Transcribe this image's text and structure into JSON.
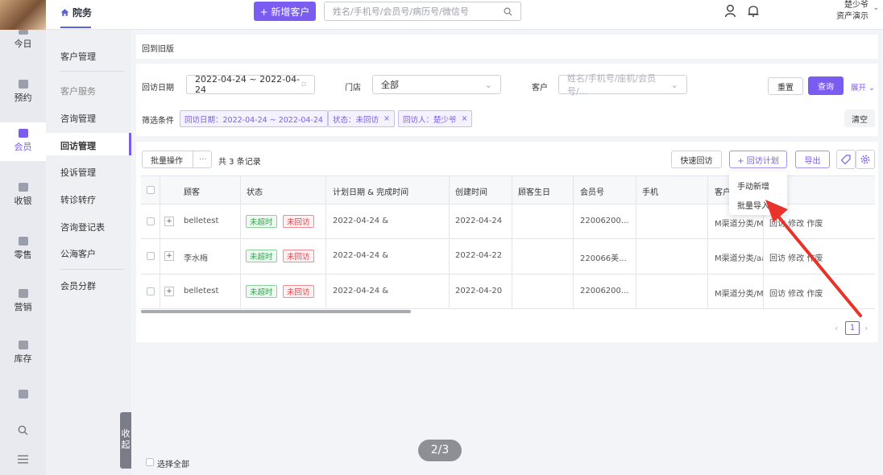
{
  "top": {
    "brand": "院务",
    "add_customer": "+ 新增客户",
    "search_placeholder": "姓名/手机号/会员号/病历号/微信号",
    "user_name": "楚少爷",
    "user_role": "资产演示"
  },
  "leftnav": [
    {
      "label": "今日",
      "icon": "calendar-icon"
    },
    {
      "label": "预约",
      "icon": "appointment-icon"
    },
    {
      "label": "会员",
      "icon": "members-icon"
    },
    {
      "label": "收银",
      "icon": "cashier-icon"
    },
    {
      "label": "零售",
      "icon": "retail-icon"
    },
    {
      "label": "营销",
      "icon": "marketing-icon"
    },
    {
      "label": "库存",
      "icon": "inventory-icon"
    }
  ],
  "subnav": {
    "customer_mgmt": "客户管理",
    "items": [
      "客户服务",
      "咨询管理",
      "回访管理",
      "投诉管理",
      "转诊转疗",
      "咨询登记表",
      "公海客户"
    ],
    "groups": "会员分群",
    "collapse": "收起"
  },
  "back_link": "回到旧版",
  "filter": {
    "date_label": "回访日期",
    "date_value": "2022-04-24 ~ 2022-04-24",
    "store_label": "门店",
    "store_value": "全部",
    "customer_label": "客户",
    "customer_placeholder": "姓名/手机号/座机/会员号/...",
    "reset": "重置",
    "query": "查询",
    "expand": "展开",
    "conditions_label": "筛选条件",
    "chips": [
      "回访日期：2022-04-24 ~ 2022-04-24",
      "状态：未回访",
      "回访人：楚少爷"
    ],
    "clear": "清空"
  },
  "toolbar": {
    "batch": "批量操作",
    "more": "···",
    "count": "共 3 条记录",
    "quick": "快速回访",
    "plan": "+ 回访计划",
    "export": "导出"
  },
  "dropdown": [
    "手动新增",
    "批量导入"
  ],
  "table": {
    "headers": [
      "顾客",
      "状态",
      "计划日期 & 完成时间",
      "创建时间",
      "顾客生日",
      "会员号",
      "手机",
      "客户"
    ],
    "rows": [
      {
        "name": "belletest",
        "tag1": "未超时",
        "tag2": "未回访",
        "plan": "2022-04-24 &",
        "created": "2022-04-24",
        "birthday": "",
        "member": "22006200...",
        "phone": "",
        "source": "M渠道分类/M",
        "actions": "回访 修改 作废"
      },
      {
        "name": "李水梅",
        "tag1": "未超时",
        "tag2": "未回访",
        "plan": "2022-04-24 &",
        "created": "2022-04-22",
        "birthday": "",
        "member": "220066美...",
        "phone": "",
        "source": "M渠道分类/aa",
        "actions": "回访 修改 作废"
      },
      {
        "name": "belletest",
        "tag1": "未超时",
        "tag2": "未回访",
        "plan": "2022-04-24 &",
        "created": "2022-04-20",
        "birthday": "",
        "member": "22006200...",
        "phone": "",
        "source": "M渠道分类/M",
        "actions": "回访 修改 作废"
      }
    ]
  },
  "page": "1",
  "select_all": "选择全部",
  "page_indicator": "2/3",
  "accent": "#7b5cf0"
}
